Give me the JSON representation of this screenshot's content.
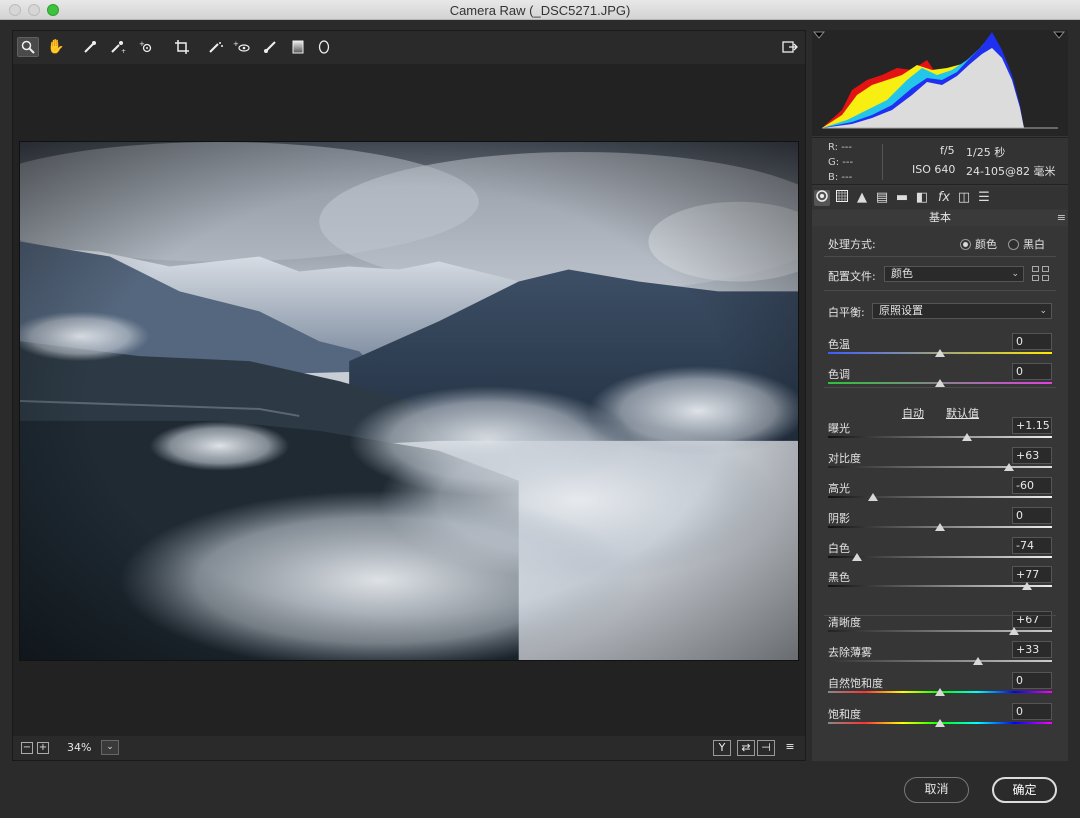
{
  "window": {
    "title": "Camera Raw (_DSC5271.JPG)"
  },
  "toolbar": {
    "tools": [
      "zoom-icon",
      "hand-icon",
      "white-balance-icon",
      "color-sampler-icon",
      "targeted-adjust-icon",
      "crop-icon",
      "spot-removal-icon",
      "red-eye-icon",
      "adjustment-brush-icon",
      "graduated-filter-icon",
      "radial-filter-icon"
    ],
    "export": "open-image-icon"
  },
  "status": {
    "zoom": "34%",
    "minus": "−",
    "plus": "+",
    "dropdown": "⌄",
    "y_label": "Y",
    "swap_label": "⇄",
    "copy_label": "⊣",
    "settings_label": "≡"
  },
  "info": {
    "r": "R:   ---",
    "g": "G:   ---",
    "b": "B:   ---",
    "aperture": "f/5",
    "shutter": "1/25 秒",
    "iso": "ISO 640",
    "lens": "24-105@82 毫米"
  },
  "panel": {
    "section_title": "基本",
    "treatment": {
      "label": "处理方式:",
      "color": "颜色",
      "bw": "黑白"
    },
    "profile": {
      "label": "配置文件:",
      "value": "颜色"
    },
    "white_balance": {
      "label": "白平衡:",
      "value": "原照设置"
    },
    "auto": "自动",
    "default": "默认值",
    "sliders": [
      {
        "label": "色温",
        "value": "0",
        "pos": 0.5
      },
      {
        "label": "色调",
        "value": "0",
        "pos": 0.5
      },
      {
        "label": "曝光",
        "value": "+1.15",
        "pos": 0.62
      },
      {
        "label": "对比度",
        "value": "+63",
        "pos": 0.81
      },
      {
        "label": "高光",
        "value": "-60",
        "pos": 0.2
      },
      {
        "label": "阴影",
        "value": "0",
        "pos": 0.5
      },
      {
        "label": "白色",
        "value": "-74",
        "pos": 0.13
      },
      {
        "label": "黑色",
        "value": "+77",
        "pos": 0.89
      },
      {
        "label": "清晰度",
        "value": "+67",
        "pos": 0.83
      },
      {
        "label": "去除薄雾",
        "value": "+33",
        "pos": 0.67
      },
      {
        "label": "自然饱和度",
        "value": "0",
        "pos": 0.5
      },
      {
        "label": "饱和度",
        "value": "0",
        "pos": 0.5
      }
    ]
  },
  "buttons": {
    "cancel": "取消",
    "ok": "确定"
  },
  "colors": {
    "accent": "#3dc23e"
  }
}
